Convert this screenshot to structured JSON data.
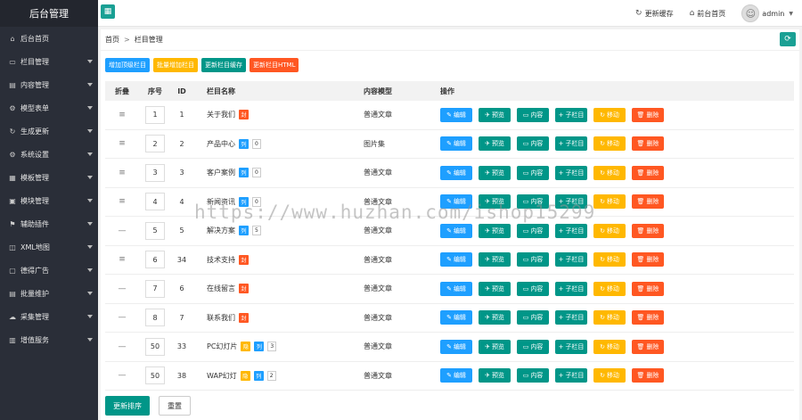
{
  "app": {
    "title": "后台管理",
    "toggle_icon": "grid-icon"
  },
  "topbar": {
    "refresh_cache": "更新缓存",
    "front_home": "前台首页",
    "user": "admin"
  },
  "sidebar": {
    "items": [
      {
        "label": "后台首页",
        "icon": "home-icon",
        "has_arrow": false
      },
      {
        "label": "栏目管理",
        "icon": "monitor-icon",
        "has_arrow": true
      },
      {
        "label": "内容管理",
        "icon": "document-icon",
        "has_arrow": true
      },
      {
        "label": "模型表单",
        "icon": "gear-icon",
        "has_arrow": true
      },
      {
        "label": "生成更新",
        "icon": "refresh-icon",
        "has_arrow": true
      },
      {
        "label": "系统设置",
        "icon": "settings-icon",
        "has_arrow": true
      },
      {
        "label": "模板管理",
        "icon": "template-icon",
        "has_arrow": true
      },
      {
        "label": "模块管理",
        "icon": "module-icon",
        "has_arrow": true
      },
      {
        "label": "辅助插件",
        "icon": "plugin-icon",
        "has_arrow": true
      },
      {
        "label": "XML地图",
        "icon": "map-icon",
        "has_arrow": true
      },
      {
        "label": "德得广告",
        "icon": "ad-icon",
        "has_arrow": true
      },
      {
        "label": "批量维护",
        "icon": "batch-icon",
        "has_arrow": true
      },
      {
        "label": "采集管理",
        "icon": "collect-icon",
        "has_arrow": true
      },
      {
        "label": "增值服务",
        "icon": "service-icon",
        "has_arrow": true
      }
    ]
  },
  "breadcrumb": {
    "home": "首页",
    "separator": ">",
    "current": "栏目管理"
  },
  "toolbar": {
    "add_top": "增加顶级栏目",
    "batch_add": "批量增加栏目",
    "update_cache": "更新栏目缓存",
    "update_html": "更新栏目HTML"
  },
  "table": {
    "headers": {
      "fold": "折叠",
      "sort": "序号",
      "id": "ID",
      "name": "栏目名称",
      "model": "内容模型",
      "ops": "操作"
    },
    "ops": {
      "edit": "编辑",
      "preview": "预览",
      "content": "内容",
      "child": "子栏目",
      "move": "移动",
      "delete": "删除"
    },
    "rows": [
      {
        "fold": "≡",
        "sort": "1",
        "id": "1",
        "name": "关于我们",
        "tags": [
          {
            "t": "封",
            "c": "#ff5722"
          }
        ],
        "count": "",
        "model": "普通文章"
      },
      {
        "fold": "≡",
        "sort": "2",
        "id": "2",
        "name": "产品中心",
        "tags": [
          {
            "t": "列",
            "c": "#1e9fff"
          }
        ],
        "count": "0",
        "model": "图片集"
      },
      {
        "fold": "≡",
        "sort": "3",
        "id": "3",
        "name": "客户案例",
        "tags": [
          {
            "t": "列",
            "c": "#1e9fff"
          }
        ],
        "count": "0",
        "model": "普通文章"
      },
      {
        "fold": "≡",
        "sort": "4",
        "id": "4",
        "name": "新闻资讯",
        "tags": [
          {
            "t": "列",
            "c": "#1e9fff"
          }
        ],
        "count": "0",
        "model": "普通文章"
      },
      {
        "fold": "—",
        "sort": "5",
        "id": "5",
        "name": "解决方案",
        "tags": [
          {
            "t": "列",
            "c": "#1e9fff"
          }
        ],
        "count": "5",
        "model": "普通文章"
      },
      {
        "fold": "≡",
        "sort": "6",
        "id": "34",
        "name": "技术支持",
        "tags": [
          {
            "t": "封",
            "c": "#ff5722"
          }
        ],
        "count": "",
        "model": "普通文章"
      },
      {
        "fold": "—",
        "sort": "7",
        "id": "6",
        "name": "在线留言",
        "tags": [
          {
            "t": "封",
            "c": "#ff5722"
          }
        ],
        "count": "",
        "model": "普通文章"
      },
      {
        "fold": "—",
        "sort": "8",
        "id": "7",
        "name": "联系我们",
        "tags": [
          {
            "t": "封",
            "c": "#ff5722"
          }
        ],
        "count": "",
        "model": "普通文章"
      },
      {
        "fold": "—",
        "sort": "50",
        "id": "33",
        "name": "PC幻灯片",
        "tags": [
          {
            "t": "隐",
            "c": "#ffb800"
          },
          {
            "t": "列",
            "c": "#1e9fff"
          }
        ],
        "count": "3",
        "model": "普通文章"
      },
      {
        "fold": "—",
        "sort": "50",
        "id": "38",
        "name": "WAP幻灯",
        "tags": [
          {
            "t": "隐",
            "c": "#ffb800"
          },
          {
            "t": "列",
            "c": "#1e9fff"
          }
        ],
        "count": "2",
        "model": "普通文章"
      }
    ]
  },
  "bottom": {
    "update_sort": "更新排序",
    "reset": "重置"
  },
  "watermark": "https://www.huzhan.com/ishop15299"
}
